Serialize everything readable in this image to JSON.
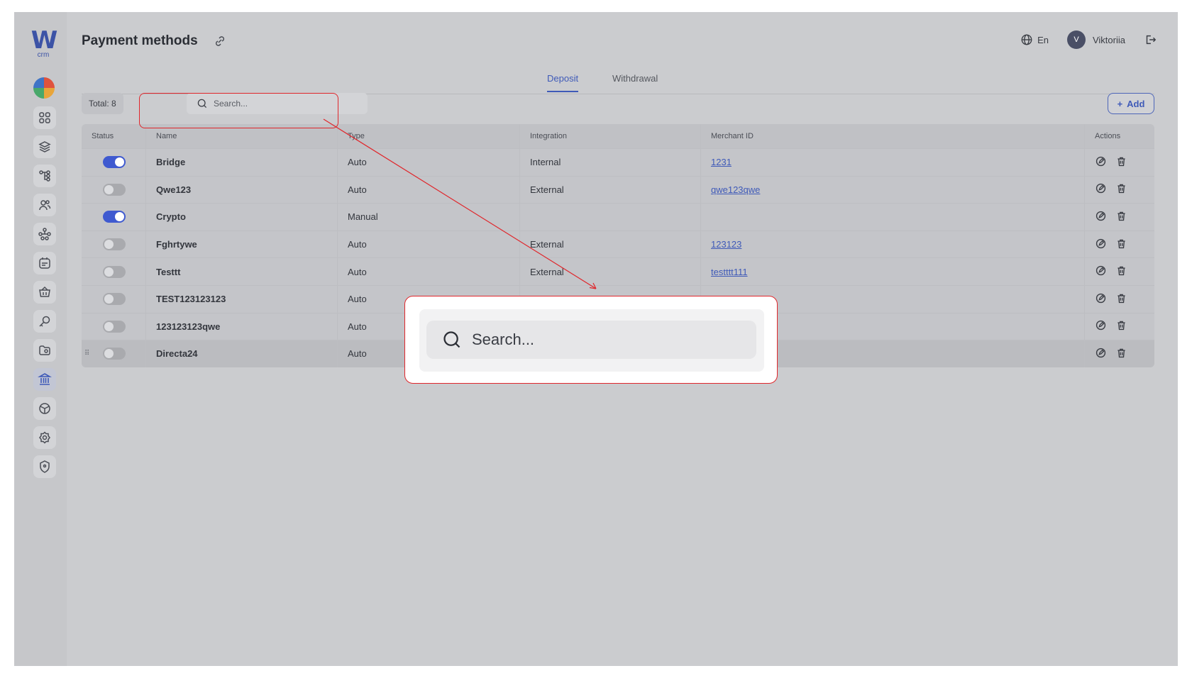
{
  "app": {
    "logo_text": "W",
    "logo_sub": "crm"
  },
  "header": {
    "title": "Payment methods",
    "language": "En",
    "user_initial": "V",
    "user_name": "Viktoriia"
  },
  "tabs": [
    {
      "label": "Deposit",
      "active": true
    },
    {
      "label": "Withdrawal",
      "active": false
    }
  ],
  "toolbar": {
    "total_label": "Total: 8",
    "search_placeholder": "Search...",
    "add_label": "Add"
  },
  "table": {
    "columns": [
      "Status",
      "Name",
      "Type",
      "Integration",
      "Merchant ID",
      "Actions"
    ],
    "rows": [
      {
        "enabled": true,
        "name": "Bridge",
        "type": "Auto",
        "integration": "Internal",
        "merchant_id": "1231"
      },
      {
        "enabled": false,
        "name": "Qwe123",
        "type": "Auto",
        "integration": "External",
        "merchant_id": "qwe123qwe"
      },
      {
        "enabled": true,
        "name": "Crypto",
        "type": "Manual",
        "integration": "",
        "merchant_id": ""
      },
      {
        "enabled": false,
        "name": "Fghrtywe",
        "type": "Auto",
        "integration": "External",
        "merchant_id": "123123"
      },
      {
        "enabled": false,
        "name": "Testtt",
        "type": "Auto",
        "integration": "External",
        "merchant_id": "testttt111"
      },
      {
        "enabled": false,
        "name": "TEST123123123",
        "type": "Auto",
        "integration": "",
        "merchant_id": ""
      },
      {
        "enabled": false,
        "name": "123123123qwe",
        "type": "Auto",
        "integration": "",
        "merchant_id": ""
      },
      {
        "enabled": false,
        "name": "Directa24",
        "type": "Auto",
        "integration": "",
        "merchant_id": ""
      }
    ]
  },
  "zoom": {
    "search_placeholder": "Search..."
  },
  "colors": {
    "accent": "#3f5ab8",
    "annotation": "#e0262b",
    "overlay": "#cbcccf"
  }
}
